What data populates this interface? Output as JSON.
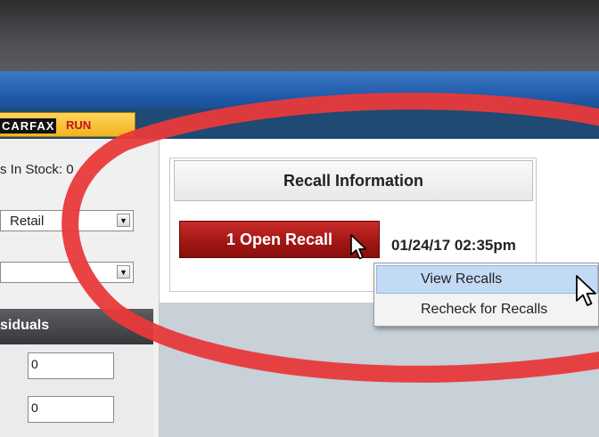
{
  "toolbar": {
    "carfax_logo": "CARFAX",
    "run_label": "RUN"
  },
  "left": {
    "stock_text": "s In Stock: 0",
    "select1_value": "Retail",
    "select2_value": "",
    "residuals_header": "siduals",
    "residual_values": [
      "0",
      "0"
    ]
  },
  "recall": {
    "header": "Recall Information",
    "button_label": "1 Open Recall",
    "timestamp": "01/24/17 02:35pm",
    "menu": [
      "View Recalls",
      "Recheck for Recalls"
    ]
  },
  "colors": {
    "annotation_circle": "#e8393a",
    "recall_button": "#b01d1b",
    "nav_blue": "#1e4a73",
    "highlight": "#c3daf5"
  }
}
